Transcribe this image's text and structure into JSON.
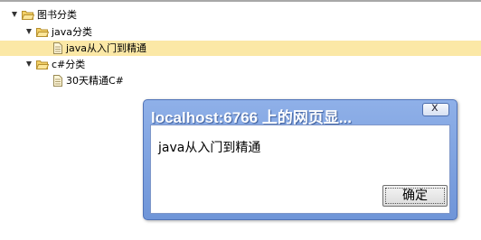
{
  "tree": {
    "nodes": [
      {
        "label": "图书分类",
        "type": "folder",
        "expanded": true
      },
      {
        "label": "java分类",
        "type": "folder",
        "expanded": true
      },
      {
        "label": "java从入门到精通",
        "type": "file",
        "selected": true
      },
      {
        "label": "c#分类",
        "type": "folder",
        "expanded": true
      },
      {
        "label": "30天精通C#",
        "type": "file"
      }
    ]
  },
  "dialog": {
    "title": "localhost:6766 上的网页显...",
    "close_label": "x",
    "message": "java从入门到精通",
    "ok_label": "确定"
  },
  "colors": {
    "selection": "#fbe8a6",
    "dialog_frame": "#7a9de0",
    "folder": "#f3d067"
  }
}
